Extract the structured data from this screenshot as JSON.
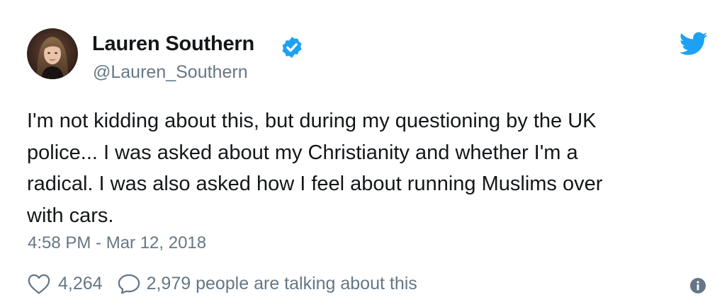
{
  "author": {
    "display_name": "Lauren Southern",
    "handle": "@Lauren_Southern",
    "verified": true,
    "avatar_icon": "profile-photo"
  },
  "tweet": {
    "lines": [
      "I'm not kidding about this, but during my questioning by the UK",
      "police... I was asked about my Christianity and whether I'm a",
      "radical. I was also asked how I feel about running Muslims over",
      "with cars."
    ],
    "timestamp": "4:58 PM - Mar 12, 2018"
  },
  "engagement": {
    "likes": "4,264",
    "talking": "2,979 people are talking about this"
  },
  "icons": {
    "like": "heart-icon",
    "reply": "speech-bubble-icon",
    "brand": "twitter-bird-icon",
    "verified": "verified-badge-icon",
    "info": "info-icon"
  },
  "colors": {
    "twitter_blue": "#1da1f2",
    "secondary_text": "#657786",
    "primary_text": "#14171a"
  }
}
